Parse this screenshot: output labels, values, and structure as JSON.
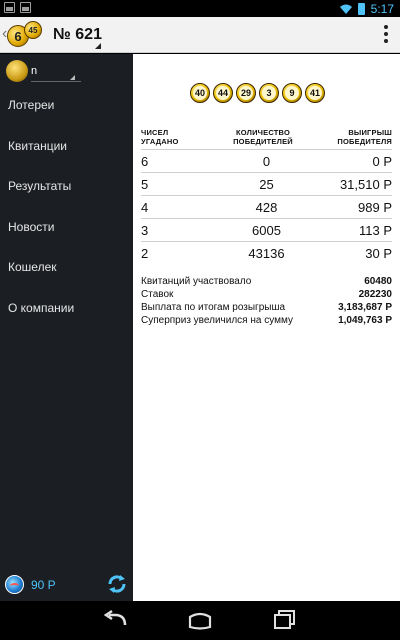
{
  "status_bar": {
    "time": "5:17",
    "icons": [
      "image-notification-icon",
      "image-notification-icon",
      "wifi-icon",
      "battery-icon"
    ]
  },
  "action_bar": {
    "logo_numbers": [
      "6",
      "45"
    ],
    "title": "№ 621",
    "overflow_icon": "overflow-menu-icon"
  },
  "drawer": {
    "user_name": "n",
    "menu": [
      "Лотереи",
      "Квитанции",
      "Результаты",
      "Новости",
      "Кошелек",
      "О компании"
    ],
    "balance": "90 Р"
  },
  "results": {
    "balls": [
      "40",
      "44",
      "29",
      "3",
      "9",
      "41"
    ],
    "headers": {
      "col1": "ЧИСЕЛ УГАДАНО",
      "col2": "КОЛИЧЕСТВО ПОБЕДИТЕЛЕЙ",
      "col3": "ВЫИГРЫШ ПОБЕДИТЕЛЯ"
    },
    "rows": [
      {
        "guessed": "6",
        "winners": "0",
        "prize": "0 Р"
      },
      {
        "guessed": "5",
        "winners": "25",
        "prize": "31,510 Р"
      },
      {
        "guessed": "4",
        "winners": "428",
        "prize": "989 Р"
      },
      {
        "guessed": "3",
        "winners": "6005",
        "prize": "113 Р"
      },
      {
        "guessed": "2",
        "winners": "43136",
        "prize": "30 Р"
      }
    ],
    "stats": [
      {
        "label": "Квитанций участвовало",
        "value": "60480"
      },
      {
        "label": "Ставок",
        "value": "282230"
      },
      {
        "label": "Выплата по итогам розыгрыша",
        "value": "3,183,687 Р"
      },
      {
        "label": "Суперприз увеличился на сумму",
        "value": "1,049,763 Р"
      }
    ]
  },
  "colors": {
    "drawer_bg": "#1b1e23",
    "accent": "#4fc3f7",
    "ball_gold": "#f0c000"
  }
}
